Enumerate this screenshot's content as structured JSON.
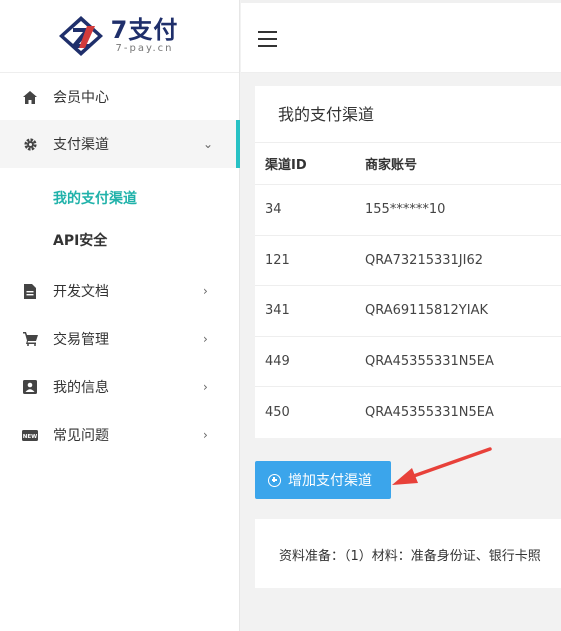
{
  "logo": {
    "title": "7支付",
    "subtitle": "7-pay.cn"
  },
  "sidebar": {
    "items": [
      {
        "label": "会员中心",
        "icon": "home-icon"
      },
      {
        "label": "支付渠道",
        "icon": "gear-icon",
        "arrow": "⌄"
      },
      {
        "label": "开发文档",
        "icon": "document-icon",
        "arrow": "›"
      },
      {
        "label": "交易管理",
        "icon": "cart-icon",
        "arrow": "›"
      },
      {
        "label": "我的信息",
        "icon": "account-box-icon",
        "arrow": "›"
      },
      {
        "label": "常见问题",
        "icon": "new-badge-icon",
        "arrow": "›"
      }
    ],
    "subitems": [
      {
        "label": "我的支付渠道"
      },
      {
        "label": "API安全"
      }
    ]
  },
  "main": {
    "card_title": "我的支付渠道",
    "table": {
      "headers": [
        "渠道ID",
        "商家账号"
      ],
      "rows": [
        [
          "34",
          "155******10"
        ],
        [
          "121",
          "QRA73215331JI62"
        ],
        [
          "341",
          "QRA69115812YIAK"
        ],
        [
          "449",
          "QRA45355331N5EA"
        ],
        [
          "450",
          "QRA45355331N5EA"
        ]
      ]
    },
    "add_button_label": "增加支付渠道",
    "note": "资料准备：（1）材料：准备身份证、银行卡照"
  },
  "colors": {
    "accent": "#20b2aa",
    "button": "#3ba5eb",
    "arrow": "#e8413a",
    "logo": "#1f2f6b"
  }
}
